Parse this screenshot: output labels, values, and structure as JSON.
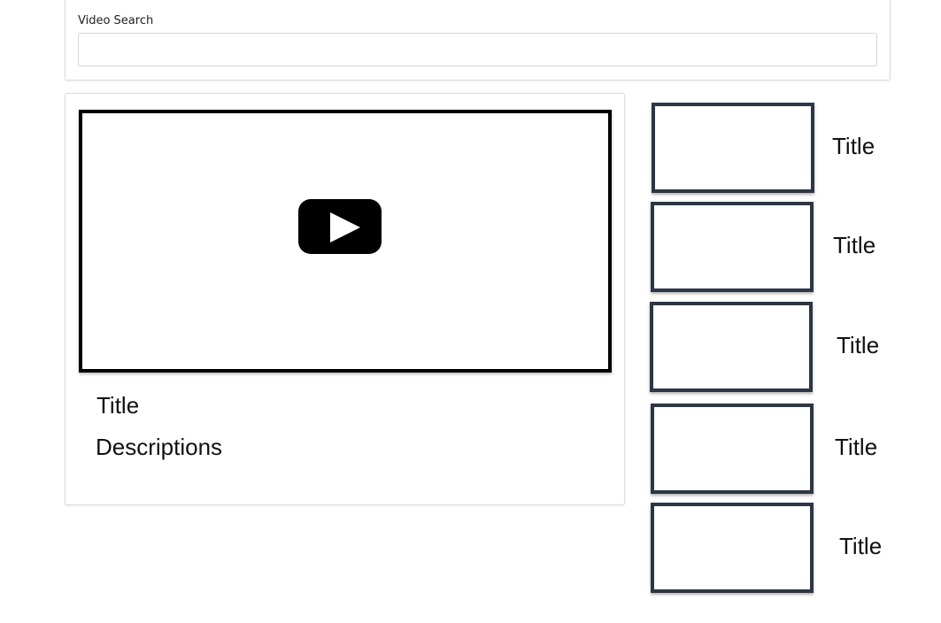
{
  "search": {
    "label": "Video Search",
    "value": "",
    "placeholder": ""
  },
  "main_video": {
    "title": "Title",
    "description": "Descriptions"
  },
  "related_videos": [
    {
      "title": "Title"
    },
    {
      "title": "Title"
    },
    {
      "title": "Title"
    },
    {
      "title": "Title"
    },
    {
      "title": "Title"
    }
  ],
  "colors": {
    "thumbnail_border": "#2c3645",
    "player_border": "#000000",
    "play_button": "#000000"
  },
  "icons": {
    "play": "play-icon"
  }
}
